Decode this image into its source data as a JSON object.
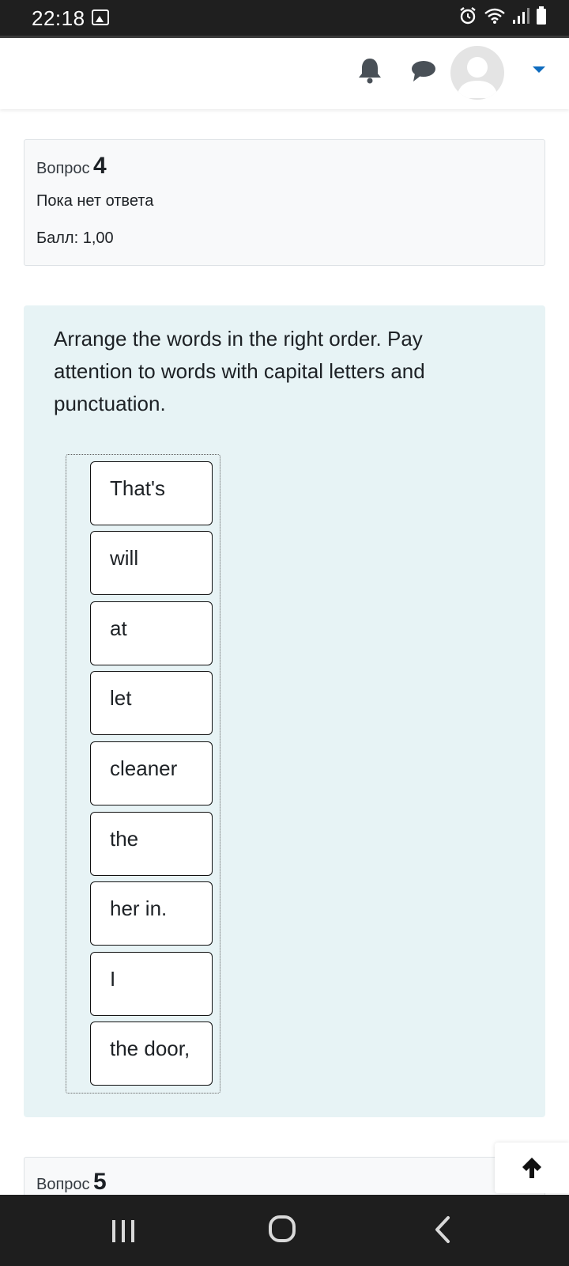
{
  "status_bar": {
    "time": "22:18",
    "icons": [
      "gallery-icon",
      "alarm-icon",
      "wifi-icon",
      "signal-icon",
      "battery-icon"
    ]
  },
  "header": {
    "icons": [
      "bell-icon",
      "chat-icon",
      "avatar",
      "chevron-down-icon"
    ],
    "accent_color": "#0f6cbf"
  },
  "question": {
    "label": "Вопрос",
    "number": "4",
    "state": "Пока нет ответа",
    "grade": "Балл: 1,00",
    "text": "Arrange the words in the right order. Pay attention to words with capital letters and punctuation.",
    "items": [
      "That's",
      "will",
      "at",
      "let",
      "cleaner",
      "the",
      "her in.",
      "I",
      "the door,"
    ]
  },
  "next_question": {
    "label": "Вопрос",
    "number": "5"
  },
  "back_to_top": {
    "icon": "arrow-up-icon"
  },
  "nav_bar": {
    "icons": [
      "recent-apps-icon",
      "home-icon",
      "back-icon"
    ]
  },
  "colors": {
    "formulation_bg": "#e7f3f5",
    "info_bg": "#f8f9fa",
    "status_bar_bg": "#1f1f1f"
  }
}
